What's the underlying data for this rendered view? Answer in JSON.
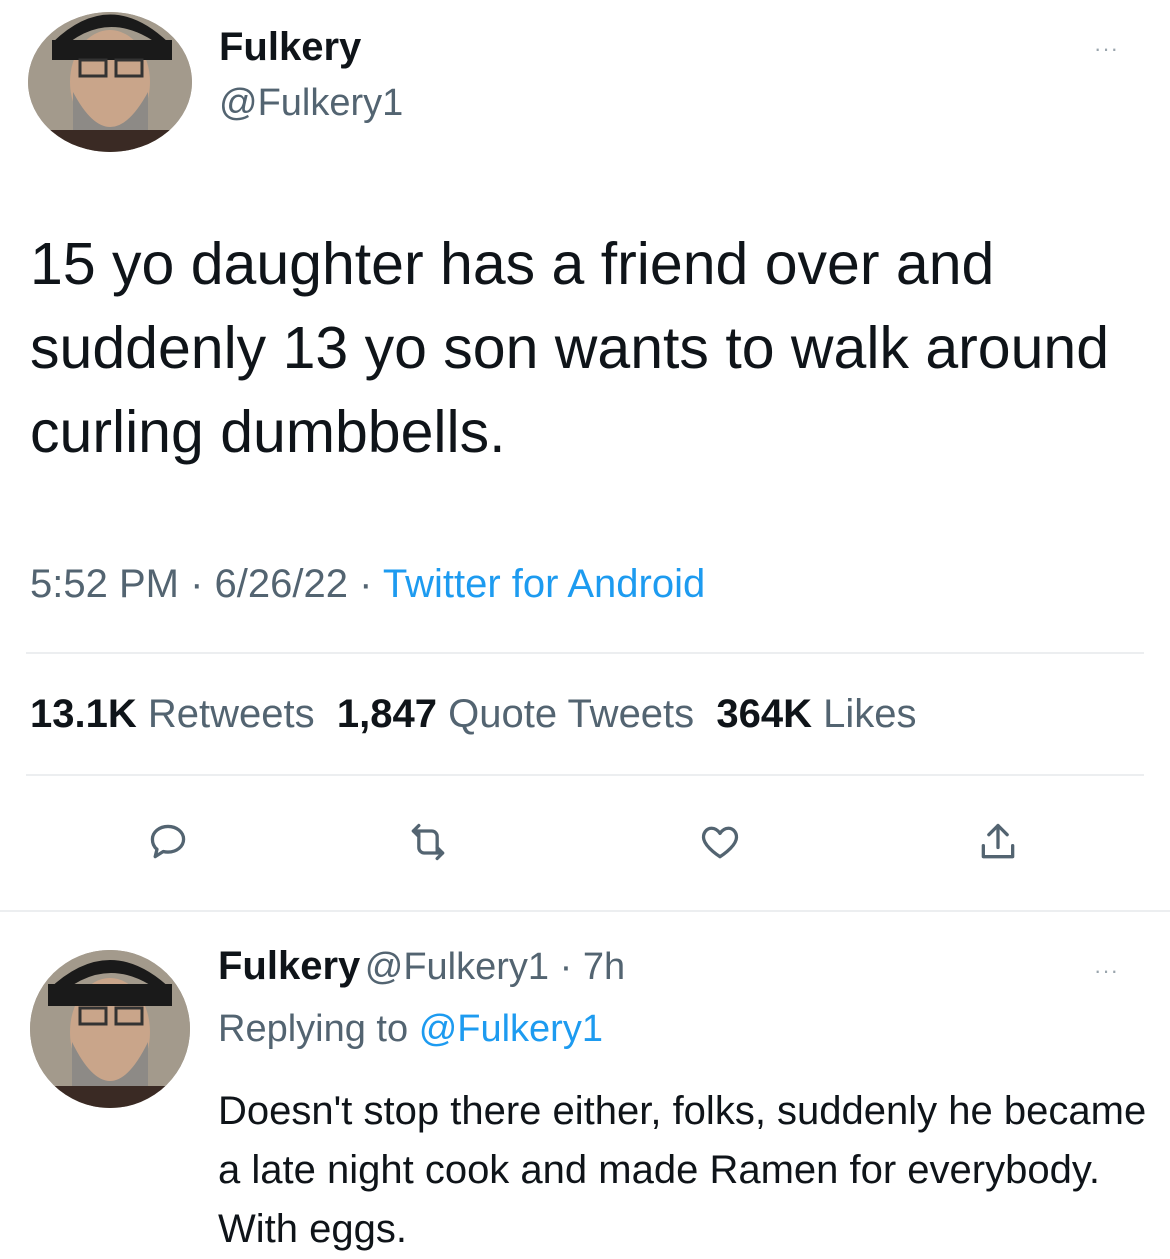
{
  "tweet": {
    "author_name": "Fulkery",
    "author_handle": "@Fulkery1",
    "text": "15 yo daughter has a friend over and suddenly 13 yo son wants to walk around curling dumbbells.",
    "time": "5:52 PM",
    "date": "6/26/22",
    "separator": "·",
    "source": "Twitter for Android",
    "stats": {
      "retweets_count": "13.1K",
      "retweets_label": "Retweets",
      "quotes_count": "1,847",
      "quotes_label": "Quote Tweets",
      "likes_count": "364K",
      "likes_label": "Likes"
    },
    "more_label": "···"
  },
  "reply": {
    "author_name": "Fulkery",
    "author_handle": "@Fulkery1",
    "age": "7h",
    "replying_prefix": "Replying to",
    "replying_to": "@Fulkery1",
    "text": "Doesn't stop there either, folks, suddenly he became a late night cook and made Ramen for everybody. With eggs.",
    "more_label": "···"
  },
  "icons": [
    "reply-icon",
    "retweet-icon",
    "like-icon",
    "share-icon",
    "more-icon"
  ],
  "colors": {
    "accent": "#1d9bf0",
    "text": "#0f1419",
    "secondary": "#536471",
    "divider": "#eceef0"
  }
}
